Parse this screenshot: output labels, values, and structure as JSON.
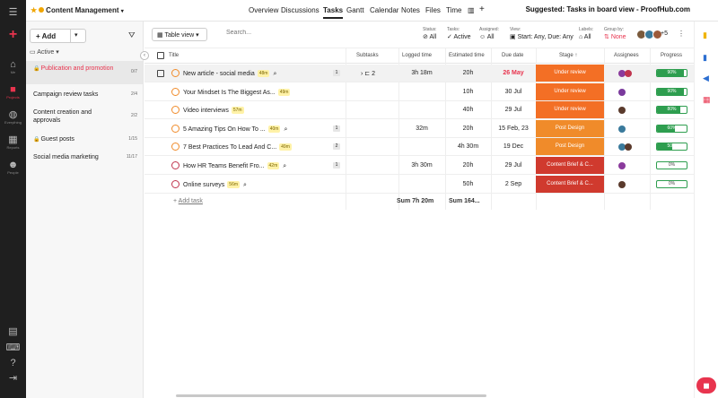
{
  "window": {
    "project_title": "Content Management",
    "suggested": "Suggested: Tasks in board view - ProofHub.com"
  },
  "nav": {
    "tabs": [
      "Overview",
      "Discussions",
      "Tasks",
      "Gantt",
      "Calendar",
      "Notes",
      "Files",
      "Time"
    ],
    "active": "Tasks"
  },
  "rail": {
    "items": [
      {
        "label": "Me",
        "icon": "home-icon"
      },
      {
        "label": "Projects",
        "icon": "folder-icon"
      },
      {
        "label": "Everything",
        "icon": "globe-icon"
      },
      {
        "label": "Reports",
        "icon": "chart-icon"
      },
      {
        "label": "People",
        "icon": "people-icon"
      }
    ]
  },
  "panel": {
    "add_label": "Add",
    "filter_label": "Active",
    "projects": [
      {
        "name": "Publication and promotion",
        "count": "0/7",
        "locked": true,
        "selected": true
      },
      {
        "name": "Campaign review tasks",
        "count": "2/4",
        "locked": false,
        "selected": false
      },
      {
        "name": "Content creation and approvals",
        "count": "2/2",
        "locked": false,
        "selected": false
      },
      {
        "name": "Guest posts",
        "count": "1/15",
        "locked": true,
        "selected": false
      },
      {
        "name": "Social media marketing",
        "count": "11/17",
        "locked": false,
        "selected": false
      }
    ]
  },
  "toolbar": {
    "view_label": "Table view",
    "search_placeholder": "Search...",
    "filters": [
      {
        "label": "Status:",
        "value": "All"
      },
      {
        "label": "Tasks:",
        "value": "Active"
      },
      {
        "label": "Assigned:",
        "value": "All"
      },
      {
        "label": "View:",
        "value": "Start: Any, Due: Any"
      },
      {
        "label": "Labels:",
        "value": "All"
      },
      {
        "label": "Group by:",
        "value": "None"
      }
    ],
    "more_assignees": "+5"
  },
  "table": {
    "headers": [
      "Title",
      "Subtasks",
      "Logged time",
      "Estimated time",
      "Due date",
      "Stage",
      "Assignees",
      "Progress"
    ],
    "rows": [
      {
        "title": "New article - social media",
        "est": "48m",
        "clip": true,
        "comments": "1",
        "subtasks": "2",
        "logged": "3h 18m",
        "estimated": "20h",
        "due": "26 May",
        "due_overdue": true,
        "stage": "Under review",
        "stage_kind": "ur",
        "progress": 90,
        "progress_label": "90%",
        "highlight": true
      },
      {
        "title": "Your Mindset Is The Biggest As...",
        "est": "49m",
        "clip": false,
        "comments": "",
        "subtasks": "",
        "logged": "",
        "estimated": "10h",
        "due": "30 Jul",
        "due_overdue": false,
        "stage": "Under review",
        "stage_kind": "ur",
        "progress": 90,
        "progress_label": "90%",
        "highlight": false
      },
      {
        "title": "Video interviews",
        "est": "57m",
        "clip": false,
        "comments": "",
        "subtasks": "",
        "logged": "",
        "estimated": "40h",
        "due": "29 Jul",
        "due_overdue": false,
        "stage": "Under review",
        "stage_kind": "ur",
        "progress": 80,
        "progress_label": "80%",
        "highlight": false
      },
      {
        "title": "5 Amazing Tips On How To ...",
        "est": "40m",
        "clip": true,
        "comments": "1",
        "subtasks": "",
        "logged": "32m",
        "estimated": "20h",
        "due": "15 Feb, 23",
        "due_overdue": false,
        "stage": "Post Design",
        "stage_kind": "pd",
        "progress": 60,
        "progress_label": "60%",
        "highlight": false
      },
      {
        "title": "7 Best Practices To Lead And C...",
        "est": "49m",
        "clip": false,
        "comments": "2",
        "subtasks": "",
        "logged": "",
        "estimated": "4h 30m",
        "due": "19 Dec",
        "due_overdue": false,
        "stage": "Post Design",
        "stage_kind": "pd",
        "progress": 50,
        "progress_label": "50%",
        "highlight": false
      },
      {
        "title": "How HR Teams Benefit Fro...",
        "est": "42m",
        "clip": true,
        "comments": "1",
        "subtasks": "",
        "logged": "3h 30m",
        "estimated": "20h",
        "due": "29 Jul",
        "due_overdue": false,
        "stage": "Content Brief & C...",
        "stage_kind": "cb2",
        "progress": 0,
        "progress_label": "0%",
        "highlight": false
      },
      {
        "title": "Online surveys",
        "est": "56m",
        "clip": true,
        "comments": "",
        "subtasks": "",
        "logged": "",
        "estimated": "50h",
        "due": "2 Sep",
        "due_overdue": false,
        "stage": "Content Brief & C...",
        "stage_kind": "cb2",
        "progress": 0,
        "progress_label": "0%",
        "highlight": false
      }
    ],
    "add_task": "Add task",
    "sum_logged": "Sum 7h 20m",
    "sum_estimated": "Sum 164..."
  },
  "colors": {
    "accent": "#e8344e",
    "under_review": "#f36f25",
    "post_design": "#f08b2a",
    "content_brief": "#d03a2e",
    "progress": "#2e9e4f"
  }
}
